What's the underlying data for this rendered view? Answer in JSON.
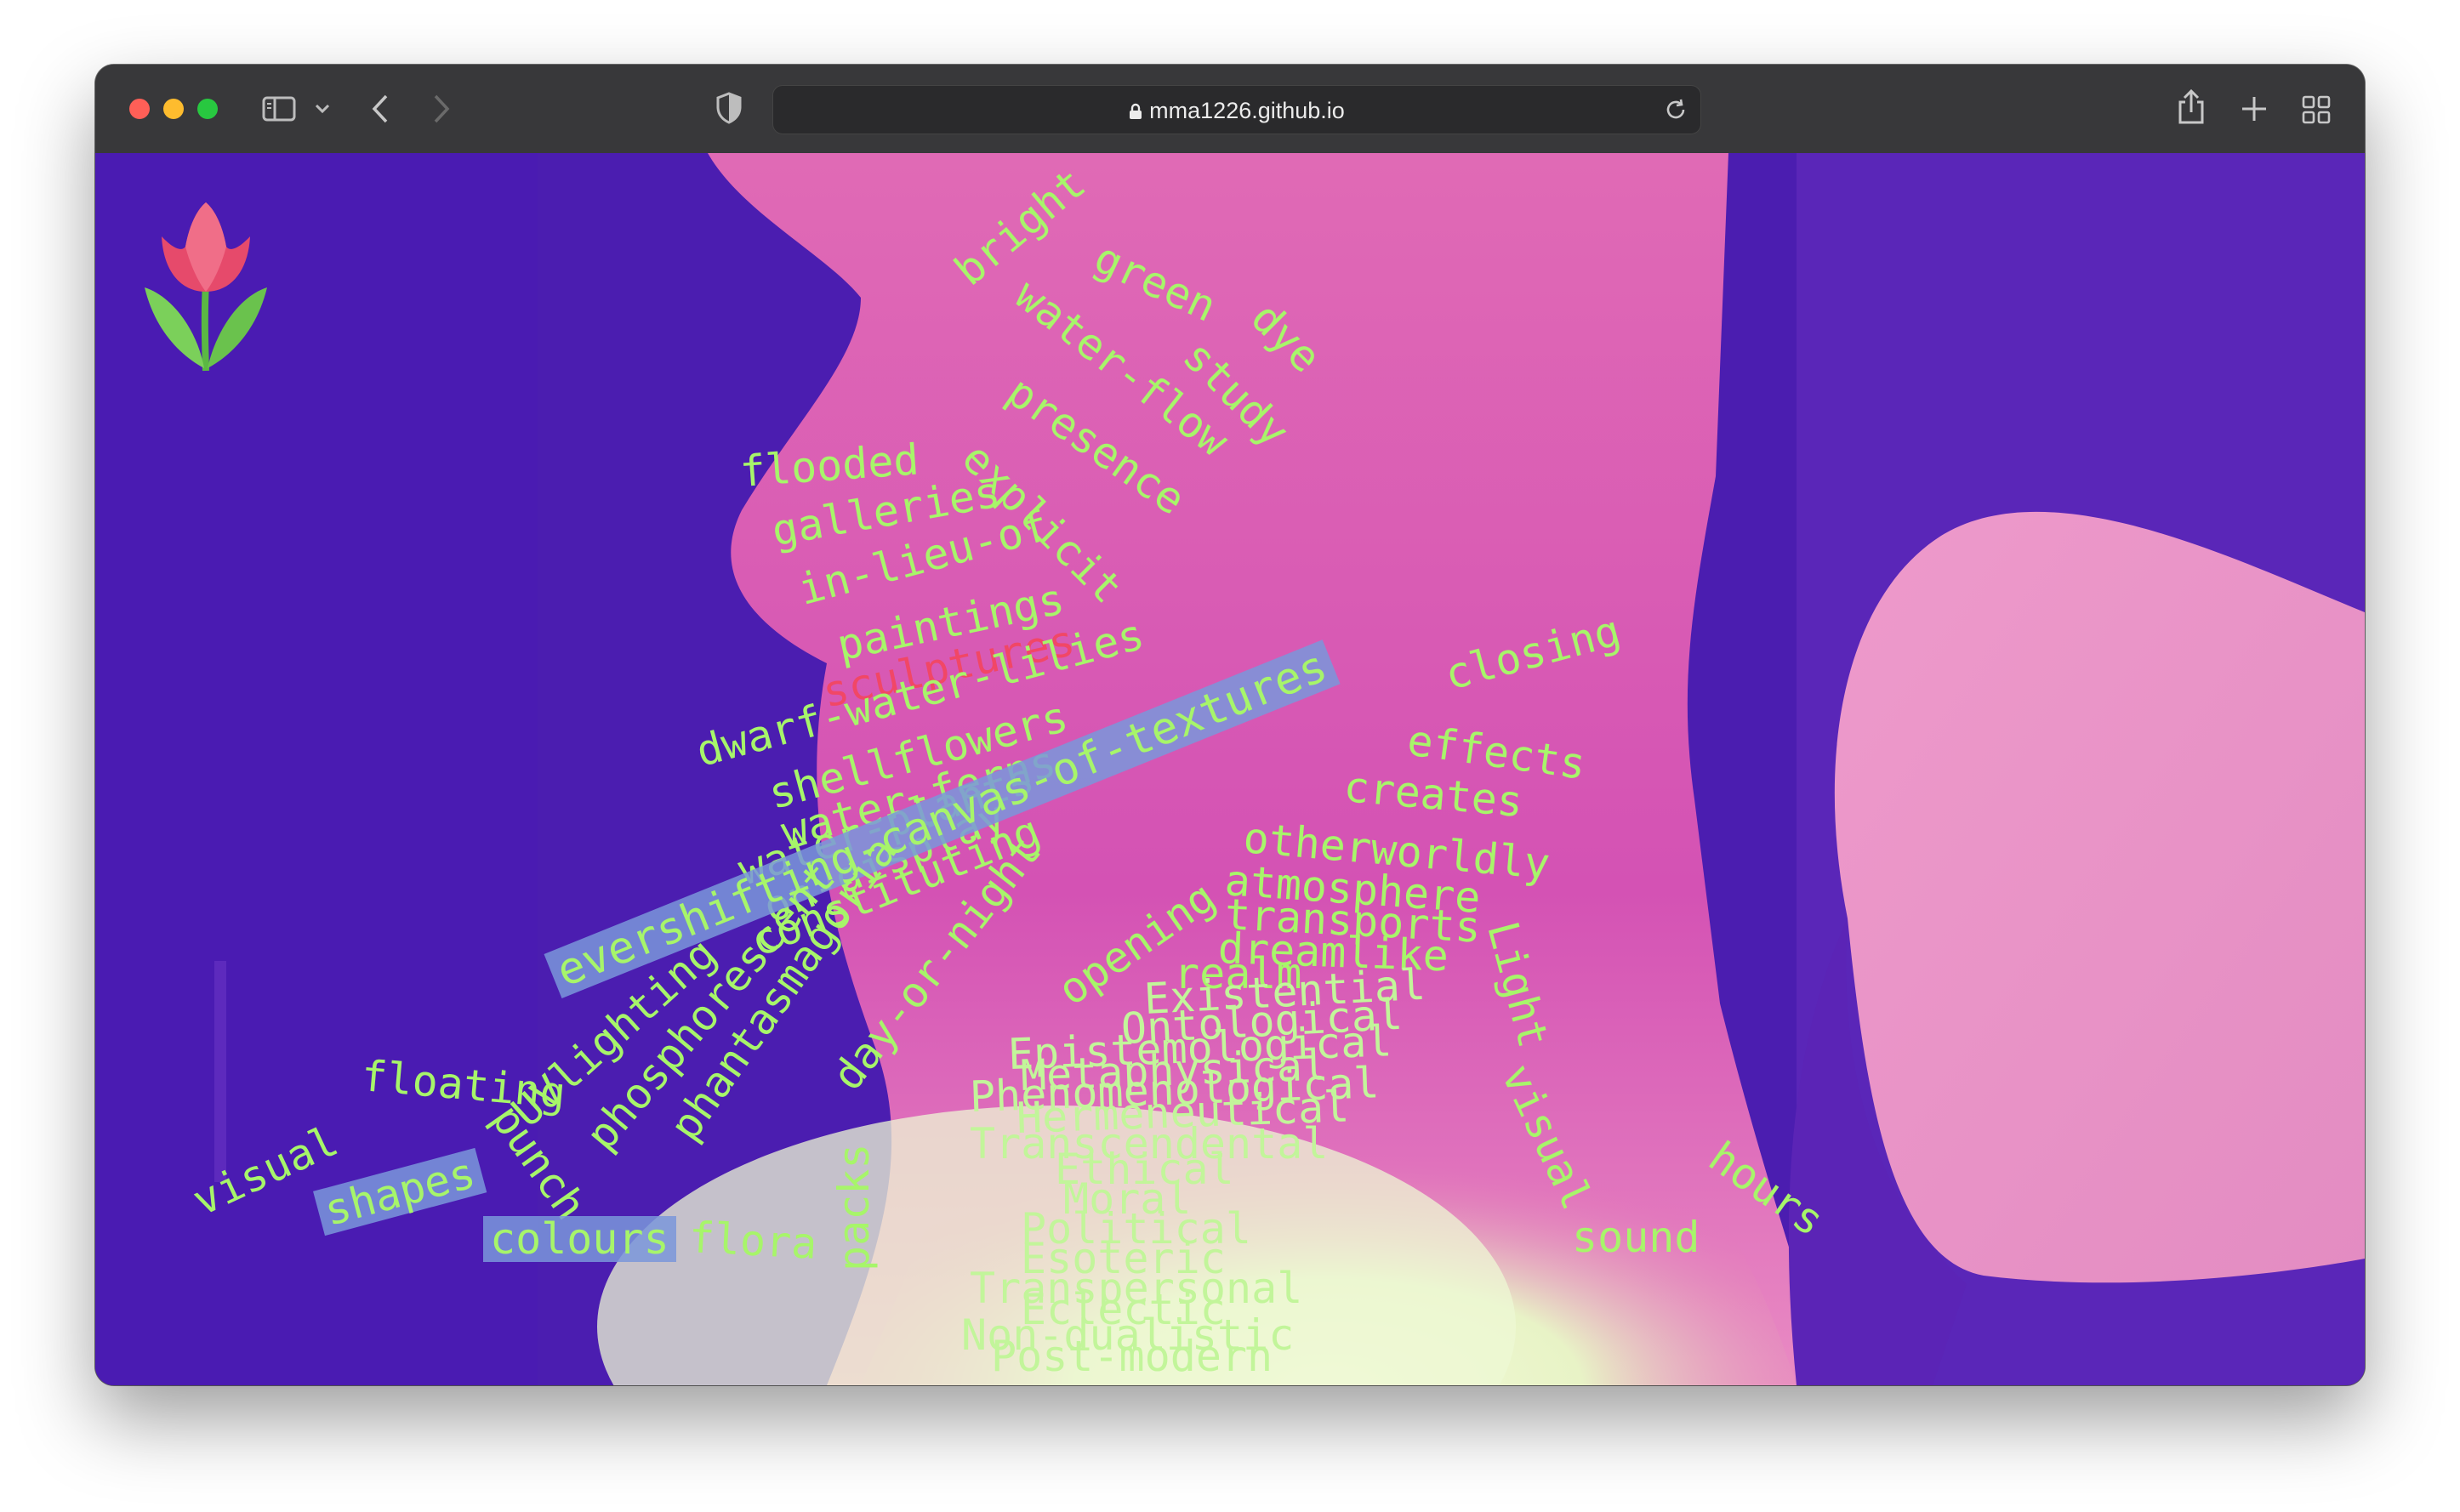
{
  "browser": {
    "url": "mma1226.github.io",
    "icons": {
      "sidebar": "sidebar-icon",
      "chevron": "chevron-down-icon",
      "back": "back-icon",
      "forward": "forward-icon",
      "shield": "shield-icon",
      "lock": "lock-icon",
      "reload": "reload-icon",
      "share": "share-icon",
      "new_tab": "plus-icon",
      "tabs": "tab-overview-icon"
    }
  },
  "page": {
    "logo_icon": "tulip-icon",
    "word_color": "#a7f56a",
    "highlight_color": "#f14766",
    "words": [
      "bright",
      "green",
      "dye",
      "water-flow",
      "study",
      "presence",
      "flooded",
      "explicit",
      "galleries",
      "in-lieu-of",
      "paintings",
      "sculptures",
      "dwarf-water-lilies",
      "shellflowers",
      "water-ferns",
      "water-plants",
      "on-display",
      "constituting",
      "evershifting-canvas-of-textures",
      "closing",
      "effects",
      "creates",
      "otherworldly",
      "atmosphere",
      "transports",
      "dreamlike",
      "realm",
      "opening",
      "Existential",
      "Ontological",
      "Epistemological",
      "Metaphysical",
      "Phenomenological",
      "Hermeneutical",
      "Transcendental",
      "Ethical",
      "Moral",
      "Political",
      "Esoteric",
      "Transpersonal",
      "Eclectic",
      "Non-dualistic",
      "Post-modern",
      "day-or-night",
      "phantasmagoria",
      "phosphorescent",
      "UVlighting",
      "punch",
      "floating",
      "visual",
      "shapes",
      "colours",
      "flora",
      "packs",
      "Light",
      "visual",
      "sound",
      "hours"
    ]
  }
}
